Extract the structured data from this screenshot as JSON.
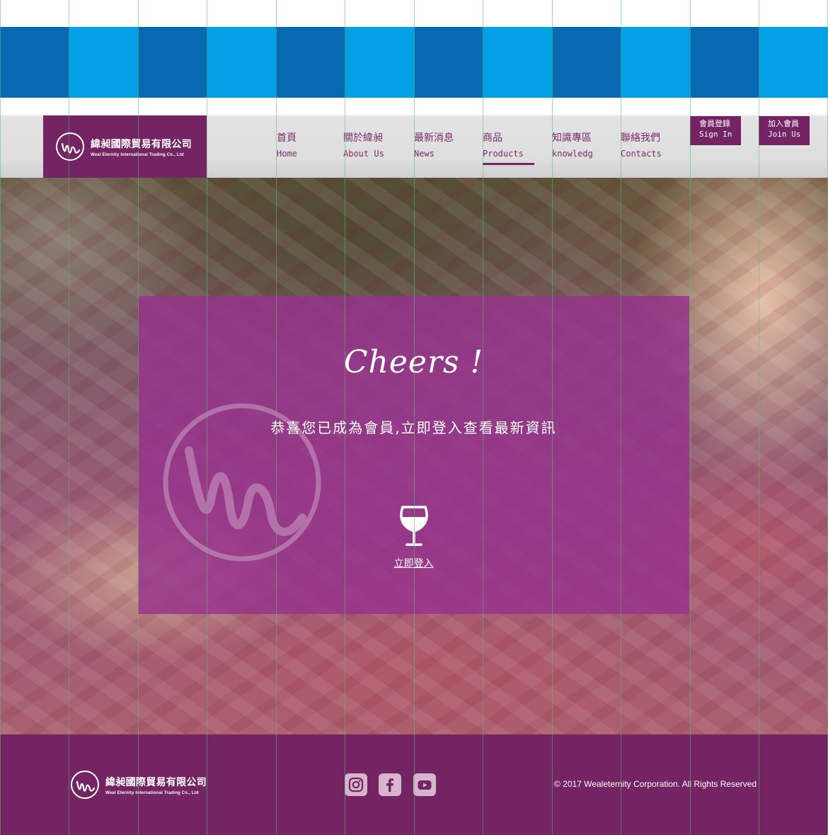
{
  "brand": {
    "name_zh": "緯昶國際貿易有限公司",
    "name_en": "Weal Eternity International Trading Co., Ltd"
  },
  "colors": {
    "brand_purple": "#742462",
    "band_dark_blue": "#0669b2",
    "band_light_blue": "#03a0e6",
    "modal_purple": "#9a3490"
  },
  "nav": {
    "items": [
      {
        "zh": "首頁",
        "en": "Home",
        "active": false
      },
      {
        "zh": "關於緯昶",
        "en": "About Us",
        "active": false
      },
      {
        "zh": "最新消息",
        "en": "News",
        "active": false
      },
      {
        "zh": "商品",
        "en": "Products",
        "active": true
      },
      {
        "zh": "知識專區",
        "en": "knowledg",
        "active": false
      },
      {
        "zh": "聯絡我們",
        "en": "Contacts",
        "active": false
      }
    ],
    "sign_in": {
      "zh": "會員登錄",
      "en": "Sign In"
    },
    "join": {
      "zh": "加入會員",
      "en": "Join Us"
    }
  },
  "modal": {
    "heading": "Cheers !",
    "message": "恭喜您已成為會員,立即登入查看最新資訊",
    "login_link": "立即登入",
    "icon": "wine-glass-icon"
  },
  "footer": {
    "social_icons": [
      "instagram-icon",
      "facebook-icon",
      "youtube-icon"
    ],
    "copyright": "© 2017 Wealeternity Corporation. All Rights Reserved"
  }
}
